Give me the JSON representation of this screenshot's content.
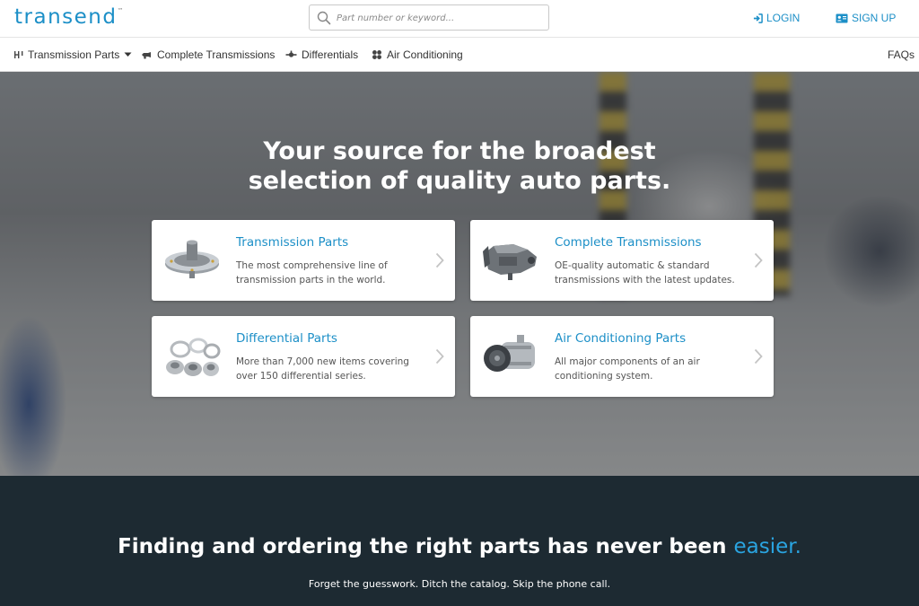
{
  "header": {
    "logo_text": "transend",
    "logo_tm": "™",
    "search_placeholder": "Part number or keyword...",
    "login_label": "LOGIN",
    "signup_label": "SIGN UP"
  },
  "nav": {
    "items": [
      {
        "label": "Transmission Parts",
        "icon": "gears-icon",
        "dropdown": true
      },
      {
        "label": "Complete Transmissions",
        "icon": "transmission-icon"
      },
      {
        "label": "Differentials",
        "icon": "differential-icon"
      },
      {
        "label": "Air Conditioning",
        "icon": "fan-icon"
      }
    ],
    "faqs_label": "FAQs"
  },
  "hero": {
    "title_line1": "Your source for the broadest",
    "title_line2": "selection of quality auto parts."
  },
  "cards": [
    {
      "title": "Transmission Parts",
      "desc": "The most comprehensive line of transmission parts in the world.",
      "image": "transmission-part-image"
    },
    {
      "title": "Complete Transmissions",
      "desc": "OE-quality automatic & standard transmissions with the latest updates.",
      "image": "transmission-image"
    },
    {
      "title": "Differential Parts",
      "desc": "More than 7,000 new items covering over 150 differential series.",
      "image": "bearings-image"
    },
    {
      "title": "Air Conditioning Parts",
      "desc": "All major components of an air conditioning system.",
      "image": "ac-compressor-image"
    }
  ],
  "band": {
    "title_main": "Finding and ordering the right parts has never been ",
    "title_accent": "easier.",
    "subtitle": "Forget the guesswork. Ditch the catalog. Skip the phone call."
  },
  "colors": {
    "brand": "#1c8fc7",
    "band_bg": "#1d2a32",
    "accent": "#2aa4e0"
  }
}
